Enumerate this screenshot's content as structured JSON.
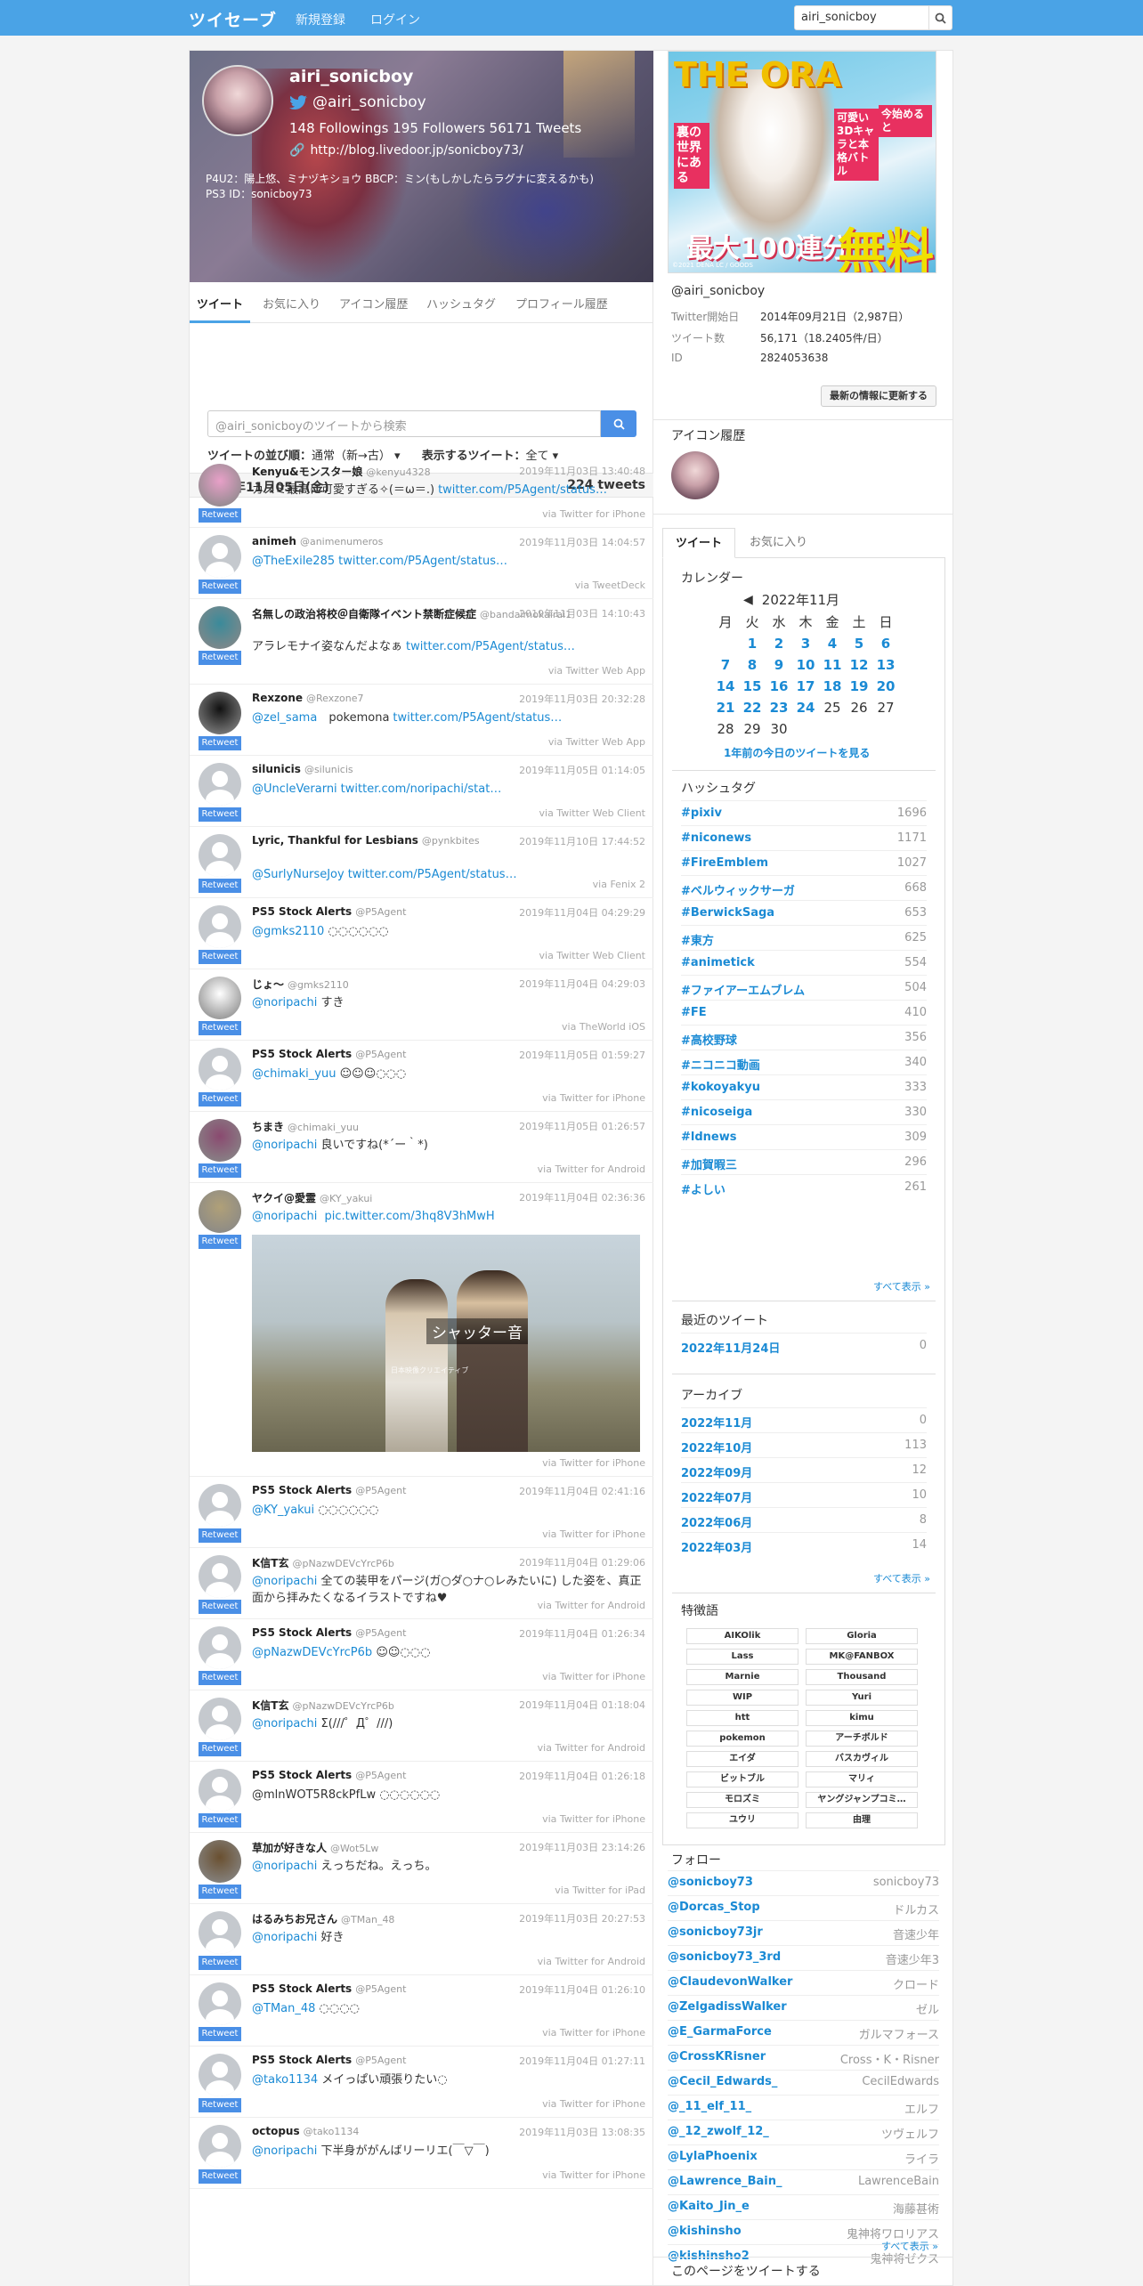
{
  "topbar": {
    "logo": "ツイセーブ",
    "nav": [
      "新規登録",
      "ログイン"
    ],
    "search_value": "airi_sonicboy"
  },
  "profile": {
    "name": "airi_sonicboy",
    "handle": "@airi_sonicboy",
    "stats": "148 Followings  195 Followers  56171 Tweets",
    "url": "http://blog.livedoor.jp/sonicboy73/",
    "bio_line1": "P4U2：陽上悠、ミナヅキショウ BBCP：ミン(もしかしたらラグナに変えるかも)",
    "bio_line2": "PS3 ID：sonicboy73"
  },
  "tabs": [
    "ツイート",
    "お気に入り",
    "アイコン履歴",
    "ハッシュタグ",
    "プロフィール履歴"
  ],
  "tweet_search_placeholder": "@airi_sonicboyのツイートから検索",
  "sort": {
    "label": "ツイートの並び順：",
    "value": "通常（新→古）",
    "label2": "表示するツイート：",
    "value2": "全て"
  },
  "date_header": {
    "date": "2021年11月05日(金)",
    "count": "224 tweets"
  },
  "retweet_label": "Retweet",
  "tweets": [
    {
      "name": "Kenyu&モンスター娘",
      "handle": "@kenyu4328",
      "date": "2019年11月03日 13:40:48",
      "mention": "",
      "text": "カスミ最高に可愛すぎる✧(＝ω＝.)",
      "link": "twitter.com/P5Agent/status…",
      "via": "via Twitter for iPhone"
    },
    {
      "name": "animeh",
      "handle": "@animenumeros",
      "date": "2019年11月03日 14:04:57",
      "mention": "@TheExile285",
      "text": "",
      "link": "twitter.com/P5Agent/status…",
      "via": "via TweetDeck"
    },
    {
      "name": "名無しの政治将校＠自衛隊イベント禁断症候症",
      "handle": "@bandaimokairai1",
      "date": "2019年11月03日 14:10:43",
      "mention": "",
      "text": "アラレモナイ姿なんだよなぁ",
      "link": "twitter.com/P5Agent/status…",
      "via": "via Twitter Web App"
    },
    {
      "name": "Rexzone",
      "handle": "@Rexzone7",
      "date": "2019年11月03日 20:32:28",
      "mention": "@zel_sama",
      "text": "　pokemona",
      "link": "twitter.com/P5Agent/status…",
      "via": "via Twitter Web App"
    },
    {
      "name": "silunicis",
      "handle": "@silunicis",
      "date": "2019年11月05日 01:14:05",
      "mention": "@UncleVerarni",
      "text": "",
      "link": "twitter.com/noripachi/stat…",
      "via": "via Twitter Web Client"
    },
    {
      "name": "Lyric, Thankful for Lesbians",
      "handle": "@pynkbites",
      "date": "2019年11月10日 17:44:52",
      "mention": "@SurlyNurseJoy",
      "text": "",
      "link": "twitter.com/P5Agent/status…",
      "via": "via Fenix 2"
    },
    {
      "name": "PS5 Stock Alerts",
      "handle": "@P5Agent",
      "date": "2019年11月04日 04:29:29",
      "mention": "@gmks2110",
      "text": " ◌◌◌◌◌◌",
      "link": "",
      "via": "via Twitter Web Client"
    },
    {
      "name": "じょ～",
      "handle": "@gmks2110",
      "date": "2019年11月04日 04:29:03",
      "mention": "@noripachi",
      "text": " すき",
      "link": "",
      "via": "via TheWorld iOS"
    },
    {
      "name": "PS5 Stock Alerts",
      "handle": "@P5Agent",
      "date": "2019年11月05日 01:59:27",
      "mention": "@chimaki_yuu",
      "text": " ☺☺☺◌◌◌",
      "link": "",
      "via": "via Twitter for iPhone"
    },
    {
      "name": "ちまき",
      "handle": "@chimaki_yuu",
      "date": "2019年11月05日 01:26:57",
      "mention": "@noripachi",
      "text": " 良いですね(*´ー｀*)",
      "link": "",
      "via": "via Twitter for Android"
    },
    {
      "name": "ヤクイ@愛霊",
      "handle": "@KY_yakui",
      "date": "2019年11月04日 02:36:36",
      "mention": "@noripachi",
      "text": " ",
      "link": "pic.twitter.com/3hq8V3hMwH",
      "via": "via Twitter for iPhone"
    },
    {
      "name": "PS5 Stock Alerts",
      "handle": "@P5Agent",
      "date": "2019年11月04日 02:41:16",
      "mention": "@KY_yakui",
      "text": " ◌◌◌◌◌◌",
      "link": "",
      "via": "via Twitter for iPhone"
    },
    {
      "name": "K信T玄",
      "handle": "@pNazwDEVcYrcP6b",
      "date": "2019年11月04日 01:29:06",
      "mention": "@noripachi",
      "text": " 全ての装甲をパージ(ガ○ダ○ナ○レみたいに) した姿を、真正面から拝みたくなるイラストですね♥",
      "link": "",
      "via": "via Twitter for Android"
    },
    {
      "name": "PS5 Stock Alerts",
      "handle": "@P5Agent",
      "date": "2019年11月04日 01:26:34",
      "mention": "@pNazwDEVcYrcP6b",
      "text": " ☺☺◌◌◌",
      "link": "",
      "via": "via Twitter for iPhone"
    },
    {
      "name": "K信T玄",
      "handle": "@pNazwDEVcYrcP6b",
      "date": "2019年11月04日 01:18:04",
      "mention": "@noripachi",
      "text": " Σ(///゜Д゜///)",
      "link": "",
      "via": "via Twitter for Android"
    },
    {
      "name": "PS5 Stock Alerts",
      "handle": "@P5Agent",
      "date": "2019年11月04日 01:26:18",
      "mention": "",
      "text": "@mlnWOT5R8ckPfLw ◌◌◌◌◌◌",
      "link": "",
      "via": "via Twitter for iPhone"
    },
    {
      "name": "草加が好きな人",
      "handle": "@Wot5Lw",
      "date": "2019年11月03日 23:14:26",
      "mention": "@noripachi",
      "text": " えっちだね。えっち。",
      "link": "",
      "via": "via Twitter for iPad"
    },
    {
      "name": "はるみちお兄さん",
      "handle": "@TMan_48",
      "date": "2019年11月03日 20:27:53",
      "mention": "@noripachi",
      "text": " 好き",
      "link": "",
      "via": "via Twitter for Android"
    },
    {
      "name": "PS5 Stock Alerts",
      "handle": "@P5Agent",
      "date": "2019年11月04日 01:26:10",
      "mention": "@TMan_48",
      "text": " ◌◌◌◌",
      "link": "",
      "via": "via Twitter for iPhone"
    },
    {
      "name": "PS5 Stock Alerts",
      "handle": "@P5Agent",
      "date": "2019年11月04日 01:27:11",
      "mention": "@tako1134",
      "text": " メイっぱい頑張りたい◌",
      "link": "",
      "via": "via Twitter for iPhone"
    },
    {
      "name": "octopus",
      "handle": "@tako1134",
      "date": "2019年11月03日 13:08:35",
      "mention": "@noripachi",
      "text": " 下半身ががんばリーリエ(￣▽￣)",
      "link": "",
      "via": "via Twitter for iPhone"
    }
  ],
  "image_caption": "シャッター音",
  "image_credits": "日本映像クリエイティブ",
  "ad": {
    "t1": "THE ORA",
    "t2": "裏の世界にある",
    "t3": "可愛い3Dキャラと本格バトル",
    "t4": "今始めると",
    "t5": "無料",
    "t6": "最大100連分",
    "t7": "©2021 DENA LC / GOODS"
  },
  "account": {
    "handle": "@airi_sonicboy",
    "rows": [
      {
        "k": "Twitter開始日",
        "v": "2014年09月21日（2,987日）"
      },
      {
        "k": "ツイート数",
        "v": "56,171（18.2405件/日）"
      },
      {
        "k": "ID",
        "v": "2824053638"
      }
    ],
    "refresh": "最新の情報に更新する"
  },
  "icon_history_title": "アイコン履歴",
  "side_tabs": [
    "ツイート",
    "お気に入り"
  ],
  "calendar": {
    "title": "カレンダー",
    "month": "2022年11月",
    "weekdays": [
      "月",
      "火",
      "水",
      "木",
      "金",
      "土",
      "日"
    ],
    "weeks": [
      [
        "",
        "1",
        "2",
        "3",
        "4",
        "5",
        "6"
      ],
      [
        "7",
        "8",
        "9",
        "10",
        "11",
        "12",
        "13"
      ],
      [
        "14",
        "15",
        "16",
        "17",
        "18",
        "19",
        "20"
      ],
      [
        "21",
        "22",
        "23",
        "24",
        "25",
        "26",
        "27"
      ],
      [
        "28",
        "29",
        "30",
        "",
        "",
        "",
        ""
      ]
    ],
    "link_days": 24,
    "year_ago": "1年前の今日のツイートを見る"
  },
  "hashtags": {
    "title": "ハッシュタグ",
    "items": [
      {
        "n": "#pixiv",
        "c": "1696"
      },
      {
        "n": "#niconews",
        "c": "1171"
      },
      {
        "n": "#FireEmblem",
        "c": "1027"
      },
      {
        "n": "#ベルウィックサーガ",
        "c": "668"
      },
      {
        "n": "#BerwickSaga",
        "c": "653"
      },
      {
        "n": "#東方",
        "c": "625"
      },
      {
        "n": "#animetick",
        "c": "554"
      },
      {
        "n": "#ファイアーエムブレム",
        "c": "504"
      },
      {
        "n": "#FE",
        "c": "410"
      },
      {
        "n": "#高校野球",
        "c": "356"
      },
      {
        "n": "#ニコニコ動画",
        "c": "340"
      },
      {
        "n": "#kokoyakyu",
        "c": "333"
      },
      {
        "n": "#nicoseiga",
        "c": "330"
      },
      {
        "n": "#ldnews",
        "c": "309"
      },
      {
        "n": "#加賀暇三",
        "c": "296"
      },
      {
        "n": "#よしい",
        "c": "261"
      }
    ],
    "more": "すべて表示 »"
  },
  "recent": {
    "title": "最近のツイート",
    "items": [
      {
        "n": "2022年11月24日",
        "c": "0"
      }
    ]
  },
  "archive": {
    "title": "アーカイブ",
    "items": [
      {
        "n": "2022年11月",
        "c": "0"
      },
      {
        "n": "2022年10月",
        "c": "113"
      },
      {
        "n": "2022年09月",
        "c": "12"
      },
      {
        "n": "2022年07月",
        "c": "10"
      },
      {
        "n": "2022年06月",
        "c": "8"
      },
      {
        "n": "2022年03月",
        "c": "14"
      }
    ],
    "more": "すべて表示 »"
  },
  "keywords": {
    "title": "特徴語",
    "items": [
      "AIKOlik",
      "Gloria",
      "Lass",
      "MK@FANBOX",
      "Marnie",
      "Thousand",
      "WIP",
      "Yuri",
      "htt",
      "kimu",
      "pokemon",
      "アーチボルド",
      "エイダ",
      "バスカヴィル",
      "ビットブル",
      "マリィ",
      "モロズミ",
      "ヤングジャンプコミ…",
      "ユウリ",
      "由理"
    ]
  },
  "follow": {
    "title": "フォロー",
    "items": [
      {
        "n": "@sonicboy73",
        "c": "sonicboy73"
      },
      {
        "n": "@Dorcas_Stop",
        "c": "ドルカス"
      },
      {
        "n": "@sonicboy73jr",
        "c": "音速少年"
      },
      {
        "n": "@sonicboy73_3rd",
        "c": "音速少年3"
      },
      {
        "n": "@ClaudevonWalker",
        "c": "クロード"
      },
      {
        "n": "@ZelgadissWalker",
        "c": "ゼル"
      },
      {
        "n": "@E_GarmaForce",
        "c": "ガルマフォース"
      },
      {
        "n": "@CrossKRisner",
        "c": "Cross・K・Risner"
      },
      {
        "n": "@Cecil_Edwards_",
        "c": "CecilEdwards"
      },
      {
        "n": "@_11_elf_11_",
        "c": "エルフ"
      },
      {
        "n": "@_12_zwolf_12_",
        "c": "ツヴェルフ"
      },
      {
        "n": "@LylaPhoenix",
        "c": "ライラ"
      },
      {
        "n": "@Lawrence_Bain_",
        "c": "LawrenceBain"
      },
      {
        "n": "@Kaito_Jin_e",
        "c": "海藤甚術"
      },
      {
        "n": "@kishinsho",
        "c": "鬼神将ワロリアス"
      },
      {
        "n": "@kishinsho2",
        "c": "鬼神将ゼクス"
      }
    ],
    "more": "すべて表示 »"
  },
  "share_title": "このページをツイートする",
  "colors": {
    "accent": "#4aa3e6",
    "link": "#1a8ad4",
    "retweet": "#4a8fe6"
  }
}
